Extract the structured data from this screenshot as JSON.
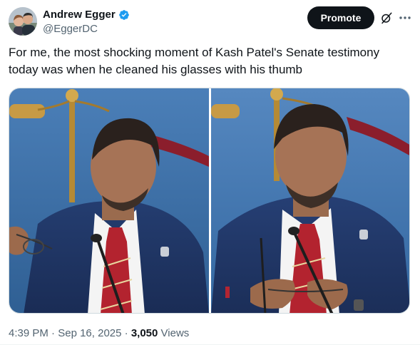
{
  "author": {
    "display_name": "Andrew Egger",
    "handle": "@EggerDC",
    "verified": true,
    "avatar_icon": "avatar-photo"
  },
  "actions": {
    "promote_label": "Promote",
    "grok_icon": "grok-icon",
    "more_icon": "more-icon"
  },
  "tweet": {
    "text_line1": "For me, the most shocking moment of Kash Patel's Senate testimony",
    "text_line2": "today was when he cleaned his glasses with his thumb"
  },
  "media": [
    {
      "name": "photo-glasses-left"
    },
    {
      "name": "photo-glasses-right"
    }
  ],
  "meta": {
    "time": "4:39 PM",
    "separator": "·",
    "date": "Sep 16, 2025",
    "views_count": "3,050",
    "views_label": "Views"
  },
  "colors": {
    "text_primary": "#0f1419",
    "text_secondary": "#536471",
    "verified_blue": "#1d9bf0",
    "button_dark": "#0f1419",
    "border": "#cfd9de"
  }
}
